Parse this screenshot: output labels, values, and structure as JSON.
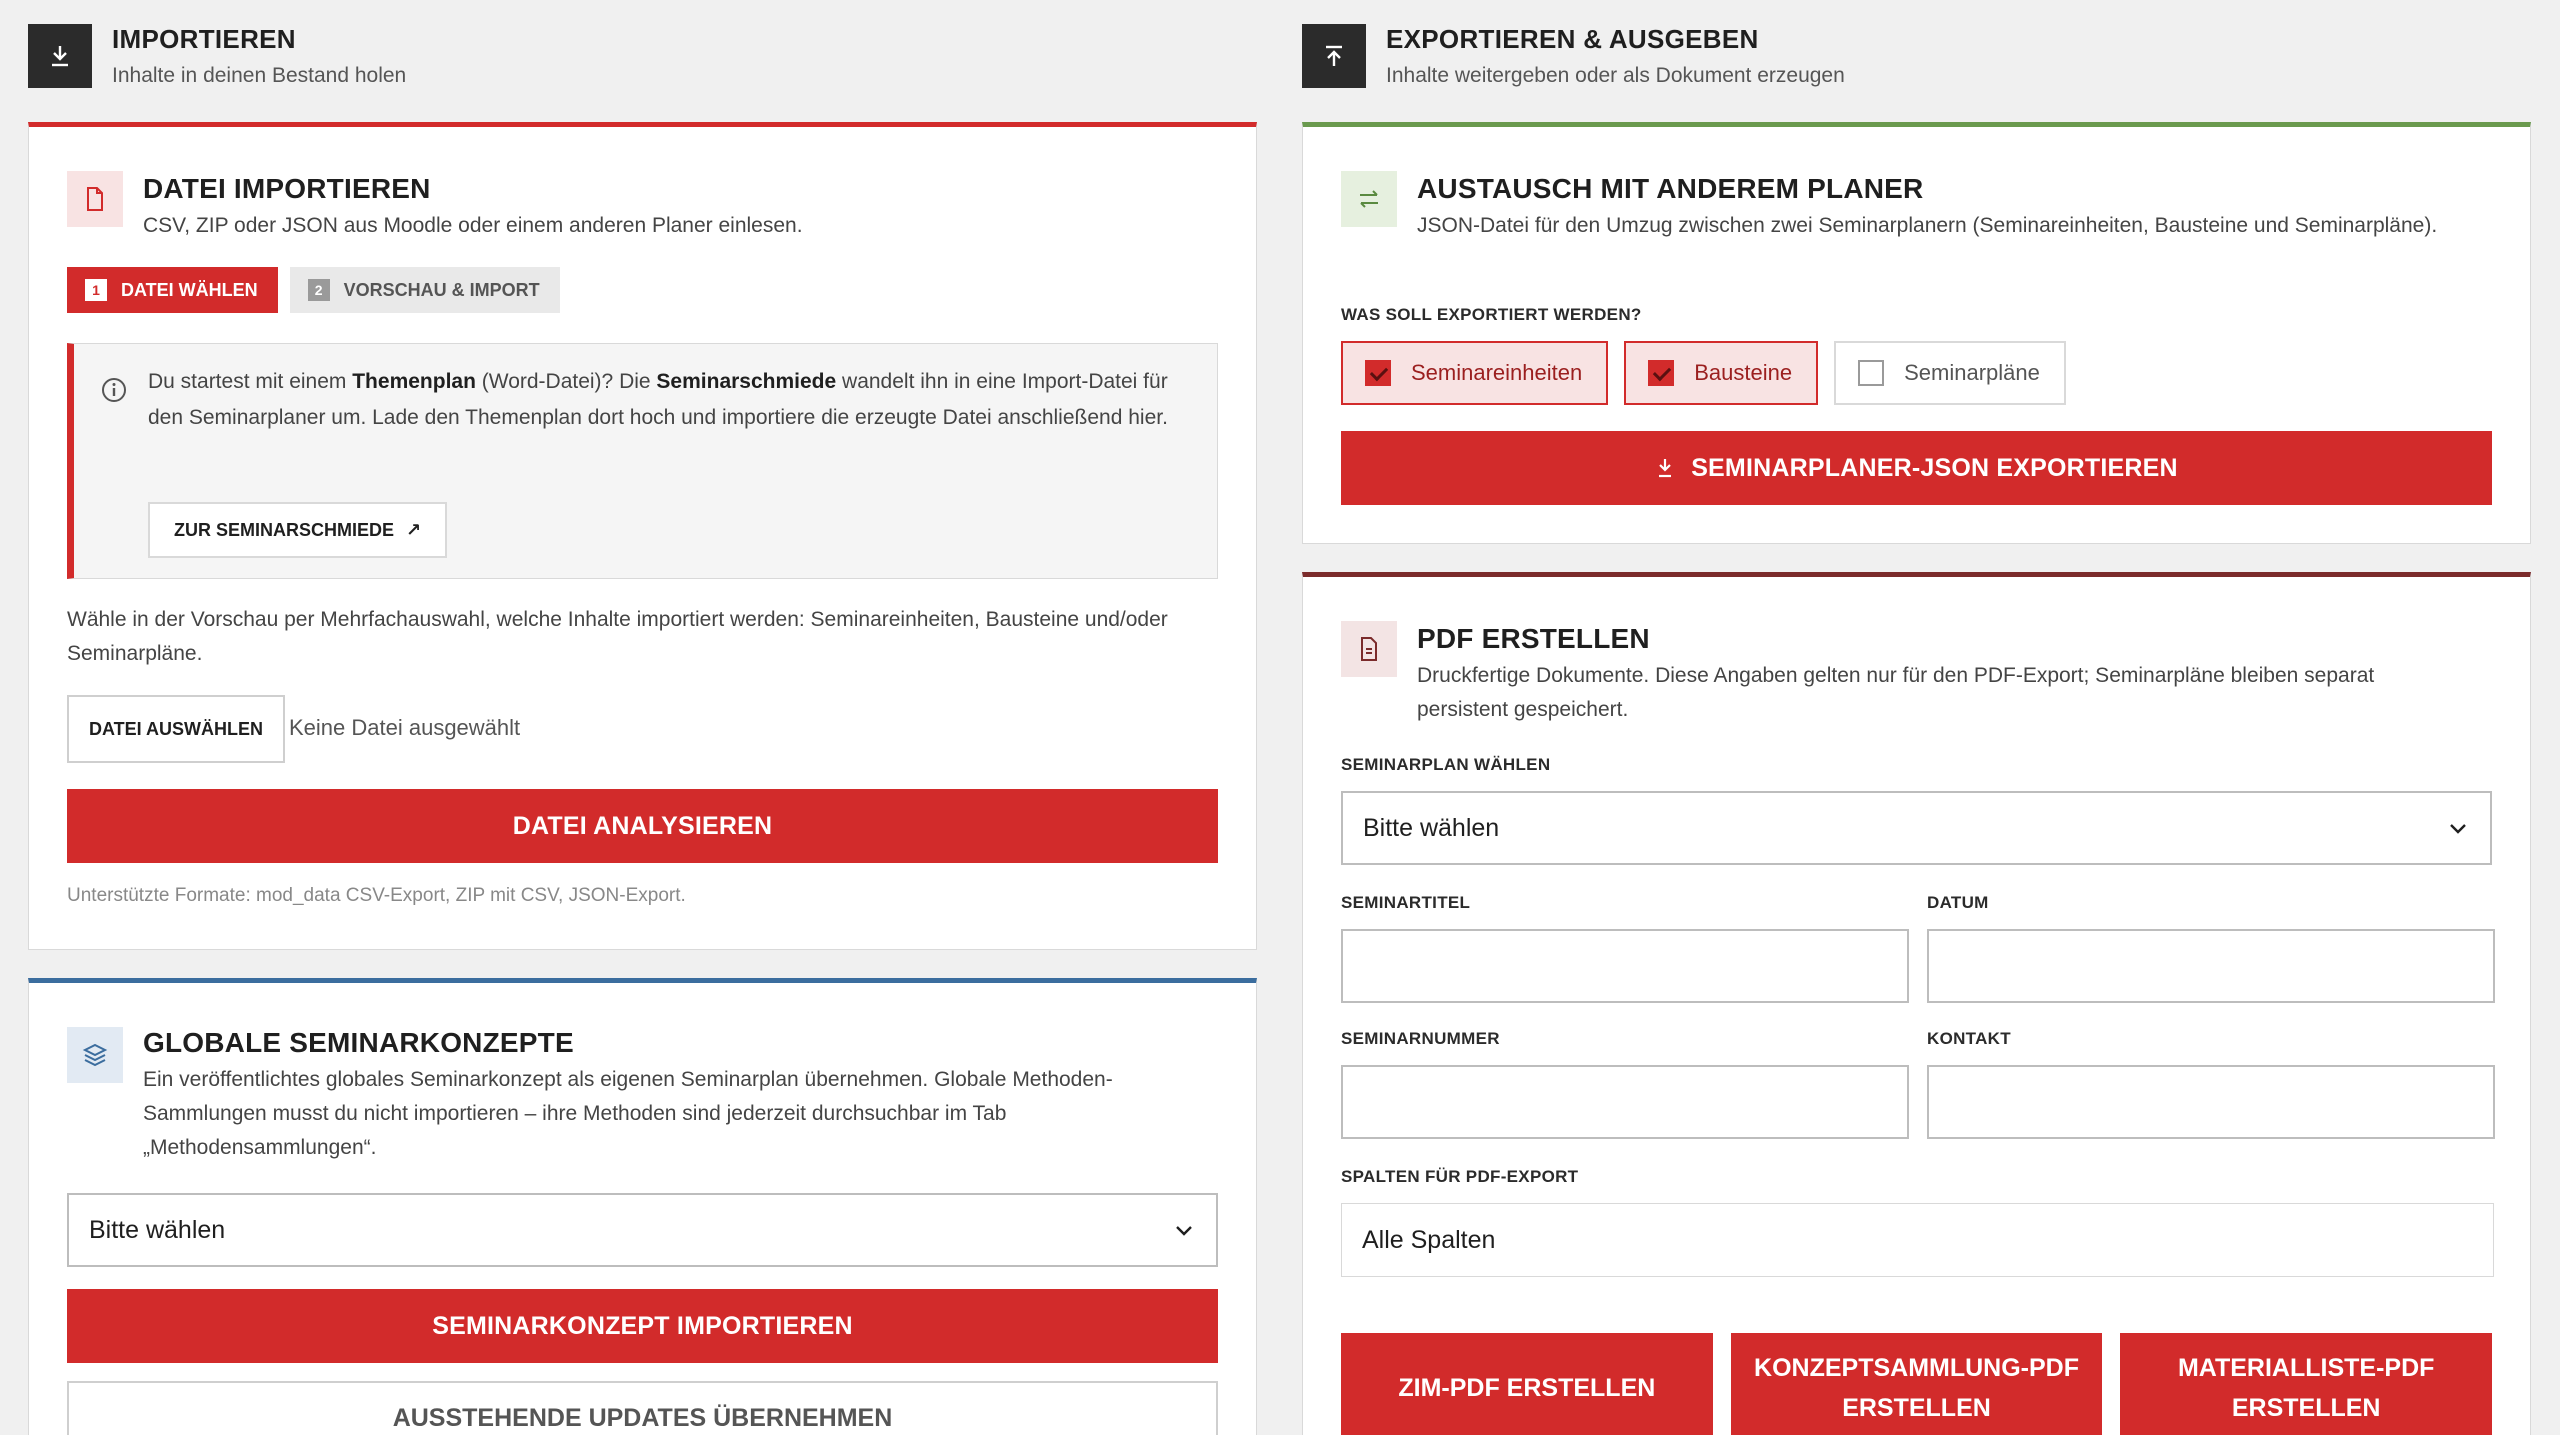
{
  "import": {
    "title": "IMPORTIEREN",
    "subtitle": "Inhalte in deinen Bestand holen",
    "icon": "download-icon",
    "file_card": {
      "title": "DATEI IMPORTIEREN",
      "desc": "CSV, ZIP oder JSON aus Moodle oder einem anderen Planer einlesen.",
      "icon": "file-icon",
      "steps": [
        {
          "num": "1",
          "label": "DATEI WÄHLEN"
        },
        {
          "num": "2",
          "label": "VORSCHAU & IMPORT"
        }
      ],
      "info": {
        "t1": "Du startest mit einem ",
        "b1": "Themenplan",
        "t2": " (Word-Datei)? Die ",
        "b2": "Seminarschmiede",
        "t3": " wandelt ihn in eine Import-Datei für den Seminarplaner um. Lade den Themenplan dort hoch und importiere die erzeugte Datei anschließend hier.",
        "link": "ZUR SEMINARSCHMIEDE",
        "link_arrow": "↗"
      },
      "hint": "Wähle in der Vorschau per Mehrfachauswahl, welche Inhalte importiert werden: Seminareinheiten, Bausteine und/oder Seminarpläne.",
      "choose_file": "DATEI AUSWÄHLEN",
      "no_file": "Keine Datei ausgewählt",
      "analyze": "DATEI ANALYSIEREN",
      "formats": "Unterstützte Formate: mod_data CSV-Export, ZIP mit CSV, JSON-Export."
    },
    "global_card": {
      "title": "GLOBALE SEMINARKONZEPTE",
      "desc": "Ein veröffentlichtes globales Seminarkonzept als eigenen Seminarplan übernehmen. Globale Methoden-Sammlungen musst du nicht importieren – ihre Methoden sind jederzeit durchsuchbar im Tab „Methodensammlungen“.",
      "icon": "layers-icon",
      "select": "Bitte wählen",
      "import_btn": "SEMINARKONZEPT IMPORTIEREN",
      "updates_btn": "AUSSTEHENDE UPDATES ÜBERNEHMEN"
    }
  },
  "export": {
    "title": "EXPORTIEREN & AUSGEBEN",
    "subtitle": "Inhalte weitergeben oder als Dokument erzeugen",
    "icon": "upload-icon",
    "exchange_card": {
      "title": "AUSTAUSCH MIT ANDEREM PLANER",
      "desc": "JSON-Datei für den Umzug zwischen zwei Seminarplanern (Seminareinheiten, Bausteine und Seminarpläne).",
      "icon": "swap-icon",
      "question": "WAS SOLL EXPORTIERT WERDEN?",
      "options": [
        {
          "label": "Seminareinheiten",
          "checked": true
        },
        {
          "label": "Bausteine",
          "checked": true
        },
        {
          "label": "Seminarpläne",
          "checked": false
        }
      ],
      "export_btn": "SEMINARPLANER-JSON EXPORTIEREN"
    },
    "pdf_card": {
      "title": "PDF ERSTELLEN",
      "desc": "Druckfertige Dokumente. Diese Angaben gelten nur für den PDF-Export; Seminarpläne bleiben separat persistent gespeichert.",
      "icon": "document-icon",
      "plan_label": "SEMINARPLAN WÄHLEN",
      "plan_select": "Bitte wählen",
      "title_label": "SEMINARTITEL",
      "date_label": "DATUM",
      "number_label": "SEMINARNUMMER",
      "contact_label": "KONTAKT",
      "columns_label": "SPALTEN FÜR PDF-EXPORT",
      "columns_value": "Alle Spalten",
      "buttons": [
        "ZIM-PDF ERSTELLEN",
        "KONZEPTSAMMLUNG-PDF ERSTELLEN",
        "MATERIALLISTE-PDF ERSTELLEN"
      ]
    }
  },
  "colors": {
    "accent_red": "#d22b2b",
    "green": "#6a9a4e",
    "blue": "#3b6d9e",
    "maroon": "#7b2b2b"
  }
}
